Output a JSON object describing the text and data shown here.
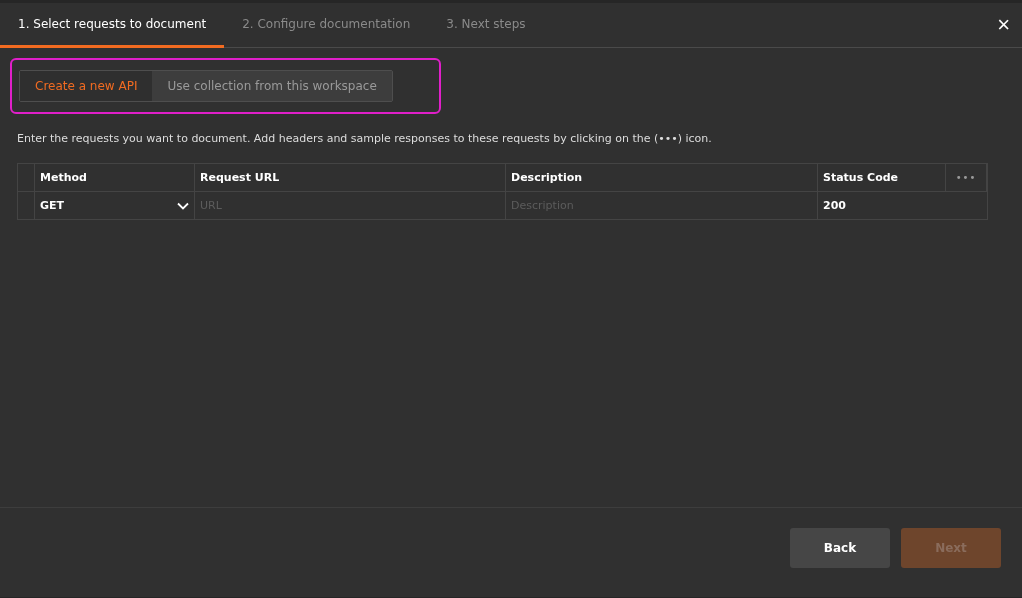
{
  "steps": [
    {
      "label": "1. Select requests to document",
      "selected": true
    },
    {
      "label": "2. Configure documentation",
      "selected": false
    },
    {
      "label": "3. Next steps",
      "selected": false
    }
  ],
  "close": "×",
  "source_toggle": {
    "highlighted": true,
    "options": [
      {
        "label": "Create a new API",
        "selected": true
      },
      {
        "label": "Use collection from this workspace",
        "selected": false
      }
    ]
  },
  "instructions": "Enter the requests you want to document. Add headers and sample responses to these requests by clicking on the (•••) icon.",
  "table": {
    "columns": [
      "Method",
      "Request URL",
      "Description",
      "Status Code"
    ],
    "menu": "•••",
    "rows": [
      {
        "method": "GET",
        "url": {
          "placeholder": "URL"
        },
        "description": {
          "placeholder": "Description"
        },
        "status": "200"
      }
    ]
  },
  "buttons": [
    {
      "label": "Back",
      "kind": "secondary",
      "disabled": false
    },
    {
      "label": "Next",
      "kind": "primary",
      "disabled": true
    }
  ]
}
